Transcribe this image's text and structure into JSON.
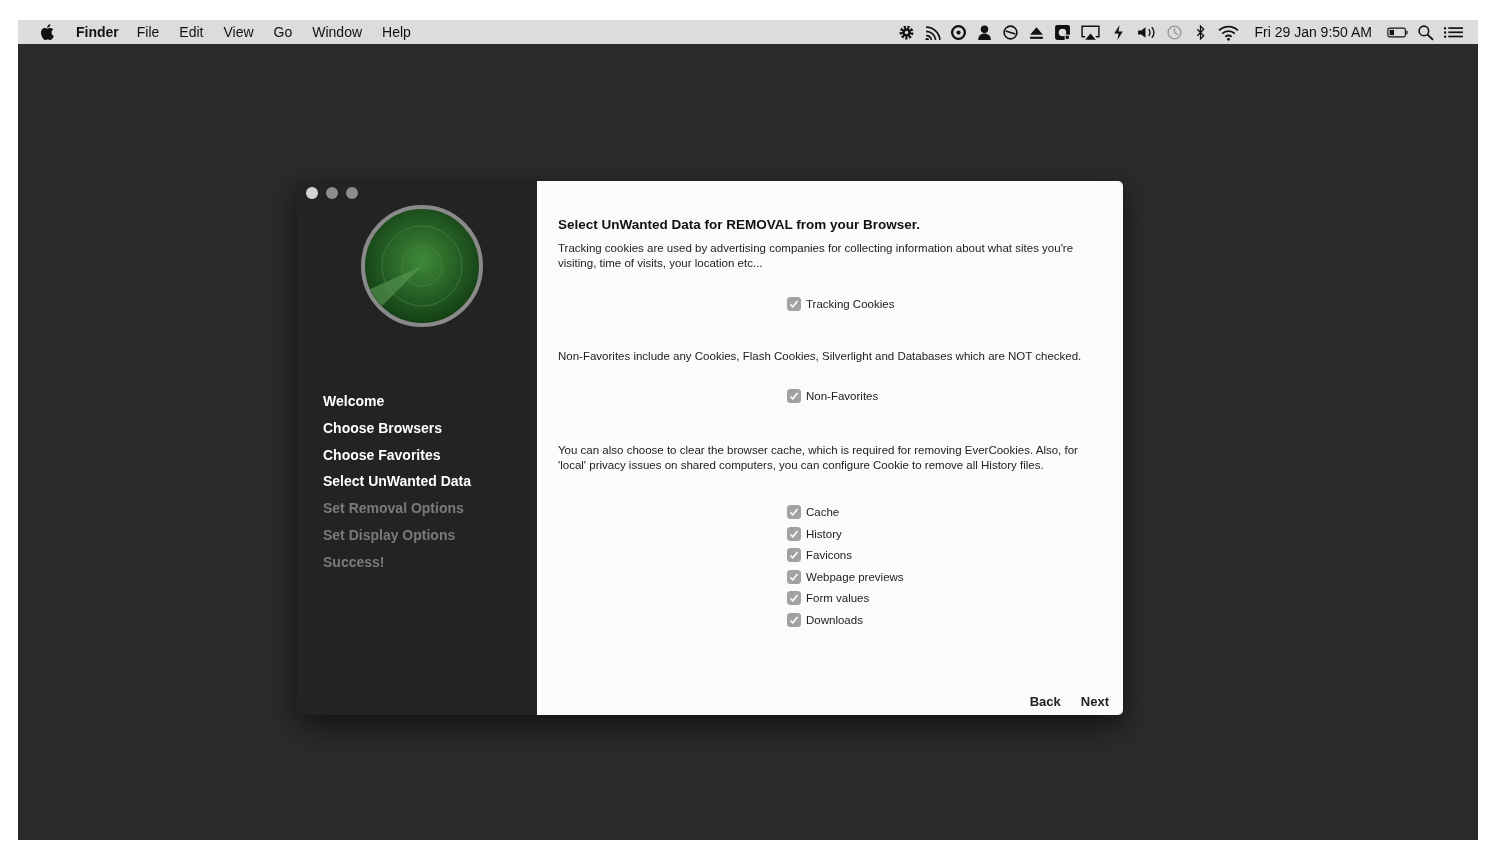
{
  "menu_bar": {
    "app": "Finder",
    "menus": [
      "File",
      "Edit",
      "View",
      "Go",
      "Window",
      "Help"
    ],
    "clock": "Fri 29 Jan  9:50 AM"
  },
  "sidebar": {
    "steps": [
      {
        "label": "Welcome",
        "done": true
      },
      {
        "label": "Choose Browsers",
        "done": true
      },
      {
        "label": "Choose Favorites",
        "done": true
      },
      {
        "label": "Select UnWanted Data",
        "done": true
      },
      {
        "label": "Set Removal Options",
        "done": false
      },
      {
        "label": "Set Display Options",
        "done": false
      },
      {
        "label": "Success!",
        "done": false
      }
    ]
  },
  "content": {
    "title": "Select UnWanted Data for REMOVAL from your Browser.",
    "sections": [
      {
        "text": "Tracking cookies are used by advertising companies for collecting information about what sites you're visiting, time of visits, your location etc...",
        "options": [
          {
            "label": "Tracking Cookies",
            "checked": true
          }
        ]
      },
      {
        "text": "Non-Favorites include any Cookies, Flash Cookies, Silverlight and Databases which are NOT checked.",
        "options": [
          {
            "label": "Non-Favorites",
            "checked": true
          }
        ]
      },
      {
        "text": "You can also choose to clear the browser cache, which is required for removing EverCookies. Also, for 'local' privacy issues on shared computers, you can configure Cookie to remove all History files.",
        "options": [
          {
            "label": "Cache",
            "checked": true
          },
          {
            "label": "History",
            "checked": true
          },
          {
            "label": "Favicons",
            "checked": true
          },
          {
            "label": "Webpage previews",
            "checked": true
          },
          {
            "label": "Form values",
            "checked": true
          },
          {
            "label": "Downloads",
            "checked": true
          }
        ]
      }
    ]
  },
  "buttons": [
    "Back",
    "Next"
  ]
}
